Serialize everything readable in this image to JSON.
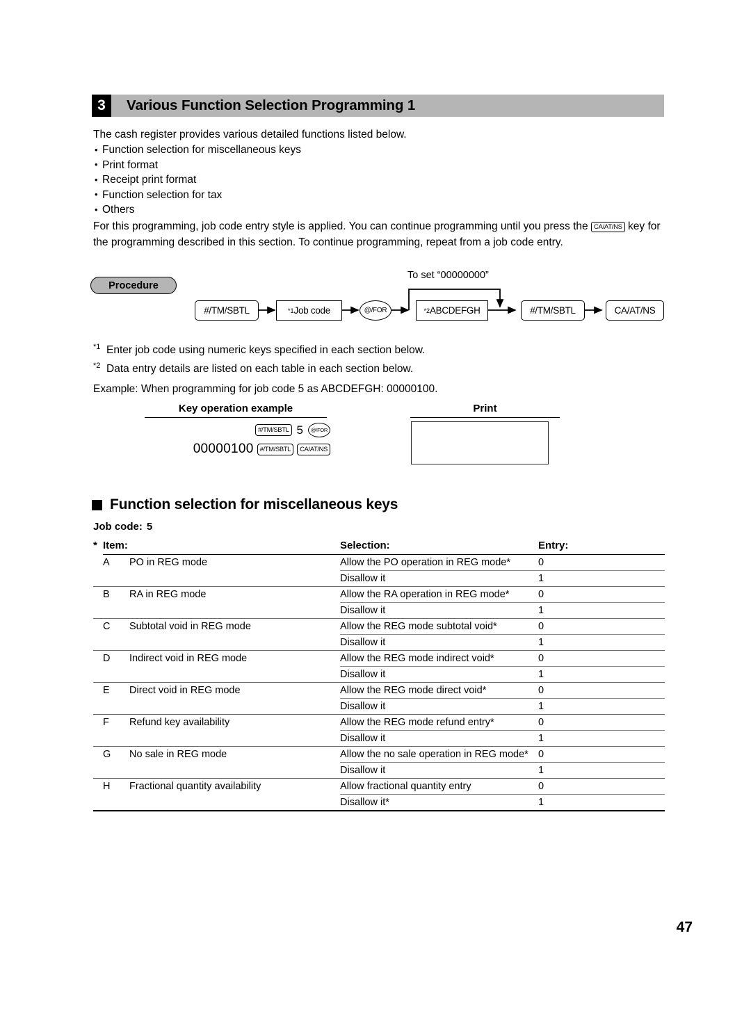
{
  "section": {
    "number": "3",
    "title": "Various Function Selection Programming 1"
  },
  "intro": {
    "lead": "The cash register provides various detailed functions listed below.",
    "bullets": [
      "Function selection for miscellaneous keys",
      "Print format",
      "Receipt print format",
      "Function selection for tax",
      "Others"
    ],
    "para_before_key": "For this programming, job code entry style is applied.  You can continue programming until you press the",
    "inline_key": "CA/AT/NS",
    "para_after_key": "key for the programming described in this section.  To continue programming, repeat from a job code entry."
  },
  "procedure": {
    "badge": "Procedure",
    "bypass_label": "To set “00000000”",
    "nodes": [
      {
        "id": "n1",
        "label": "#/TM/SBTL",
        "shape": "round"
      },
      {
        "id": "n2",
        "label": "Job code",
        "sup": "*1",
        "shape": "square"
      },
      {
        "id": "n3",
        "label": "@/FOR",
        "shape": "ellipse"
      },
      {
        "id": "n4",
        "label": "ABCDEFGH",
        "sup": "*2",
        "shape": "square"
      },
      {
        "id": "n5",
        "label": "#/TM/SBTL",
        "shape": "round"
      },
      {
        "id": "n6",
        "label": "CA/AT/NS",
        "shape": "round"
      }
    ]
  },
  "notes": {
    "note1_sup": "*1",
    "note1": "Enter job code using numeric keys specified in each section below.",
    "note2_sup": "*2",
    "note2": "Data entry details are listed on each table in each section below.",
    "example": "Example:  When programming for job code 5 as ABCDEFGH: 00000100."
  },
  "example_block": {
    "heading_left": "Key operation example",
    "heading_right": "Print",
    "row1": {
      "key1": "#/TM/SBTL",
      "digit": "5",
      "key2": "@/FOR"
    },
    "row2": {
      "number": "00000100",
      "key1": "#/TM/SBTL",
      "key2": "CA/AT/NS"
    },
    "print_content": ""
  },
  "misc_section": {
    "heading": "Function selection for miscellaneous keys",
    "job_code_label": "Job code:",
    "job_code_value": "5",
    "star": "*",
    "columns": [
      "Item:",
      "Selection:",
      "Entry:"
    ],
    "rows": [
      {
        "letter": "A",
        "item": "PO in REG mode",
        "options": [
          {
            "selection": "Allow the PO operation in REG mode*",
            "entry": "0"
          },
          {
            "selection": "Disallow it",
            "entry": "1"
          }
        ]
      },
      {
        "letter": "B",
        "item": "RA in REG mode",
        "options": [
          {
            "selection": "Allow the RA operation in REG mode*",
            "entry": "0"
          },
          {
            "selection": "Disallow it",
            "entry": "1"
          }
        ]
      },
      {
        "letter": "C",
        "item": "Subtotal void in REG mode",
        "options": [
          {
            "selection": "Allow the REG mode subtotal void*",
            "entry": "0"
          },
          {
            "selection": "Disallow it",
            "entry": "1"
          }
        ]
      },
      {
        "letter": "D",
        "item": "Indirect void in REG mode",
        "options": [
          {
            "selection": "Allow the REG mode indirect void*",
            "entry": "0"
          },
          {
            "selection": "Disallow it",
            "entry": "1"
          }
        ]
      },
      {
        "letter": "E",
        "item": "Direct void in REG mode",
        "options": [
          {
            "selection": "Allow the REG mode direct void*",
            "entry": "0"
          },
          {
            "selection": "Disallow it",
            "entry": "1"
          }
        ]
      },
      {
        "letter": "F",
        "item": "Refund key availability",
        "options": [
          {
            "selection": "Allow the REG mode refund entry*",
            "entry": "0"
          },
          {
            "selection": "Disallow it",
            "entry": "1"
          }
        ]
      },
      {
        "letter": "G",
        "item": "No sale in REG mode",
        "options": [
          {
            "selection": "Allow the no sale operation in REG mode*",
            "entry": "0"
          },
          {
            "selection": "Disallow it",
            "entry": "1"
          }
        ]
      },
      {
        "letter": "H",
        "item": "Fractional quantity availability",
        "options": [
          {
            "selection": "Allow fractional quantity entry",
            "entry": "0"
          },
          {
            "selection": "Disallow it*",
            "entry": "1"
          }
        ]
      }
    ]
  },
  "footer": {
    "page_number": "47"
  },
  "colors": {
    "header_bar": "#b5b5b5",
    "badge_fill": "#b5b5b5",
    "text": "#000000"
  }
}
